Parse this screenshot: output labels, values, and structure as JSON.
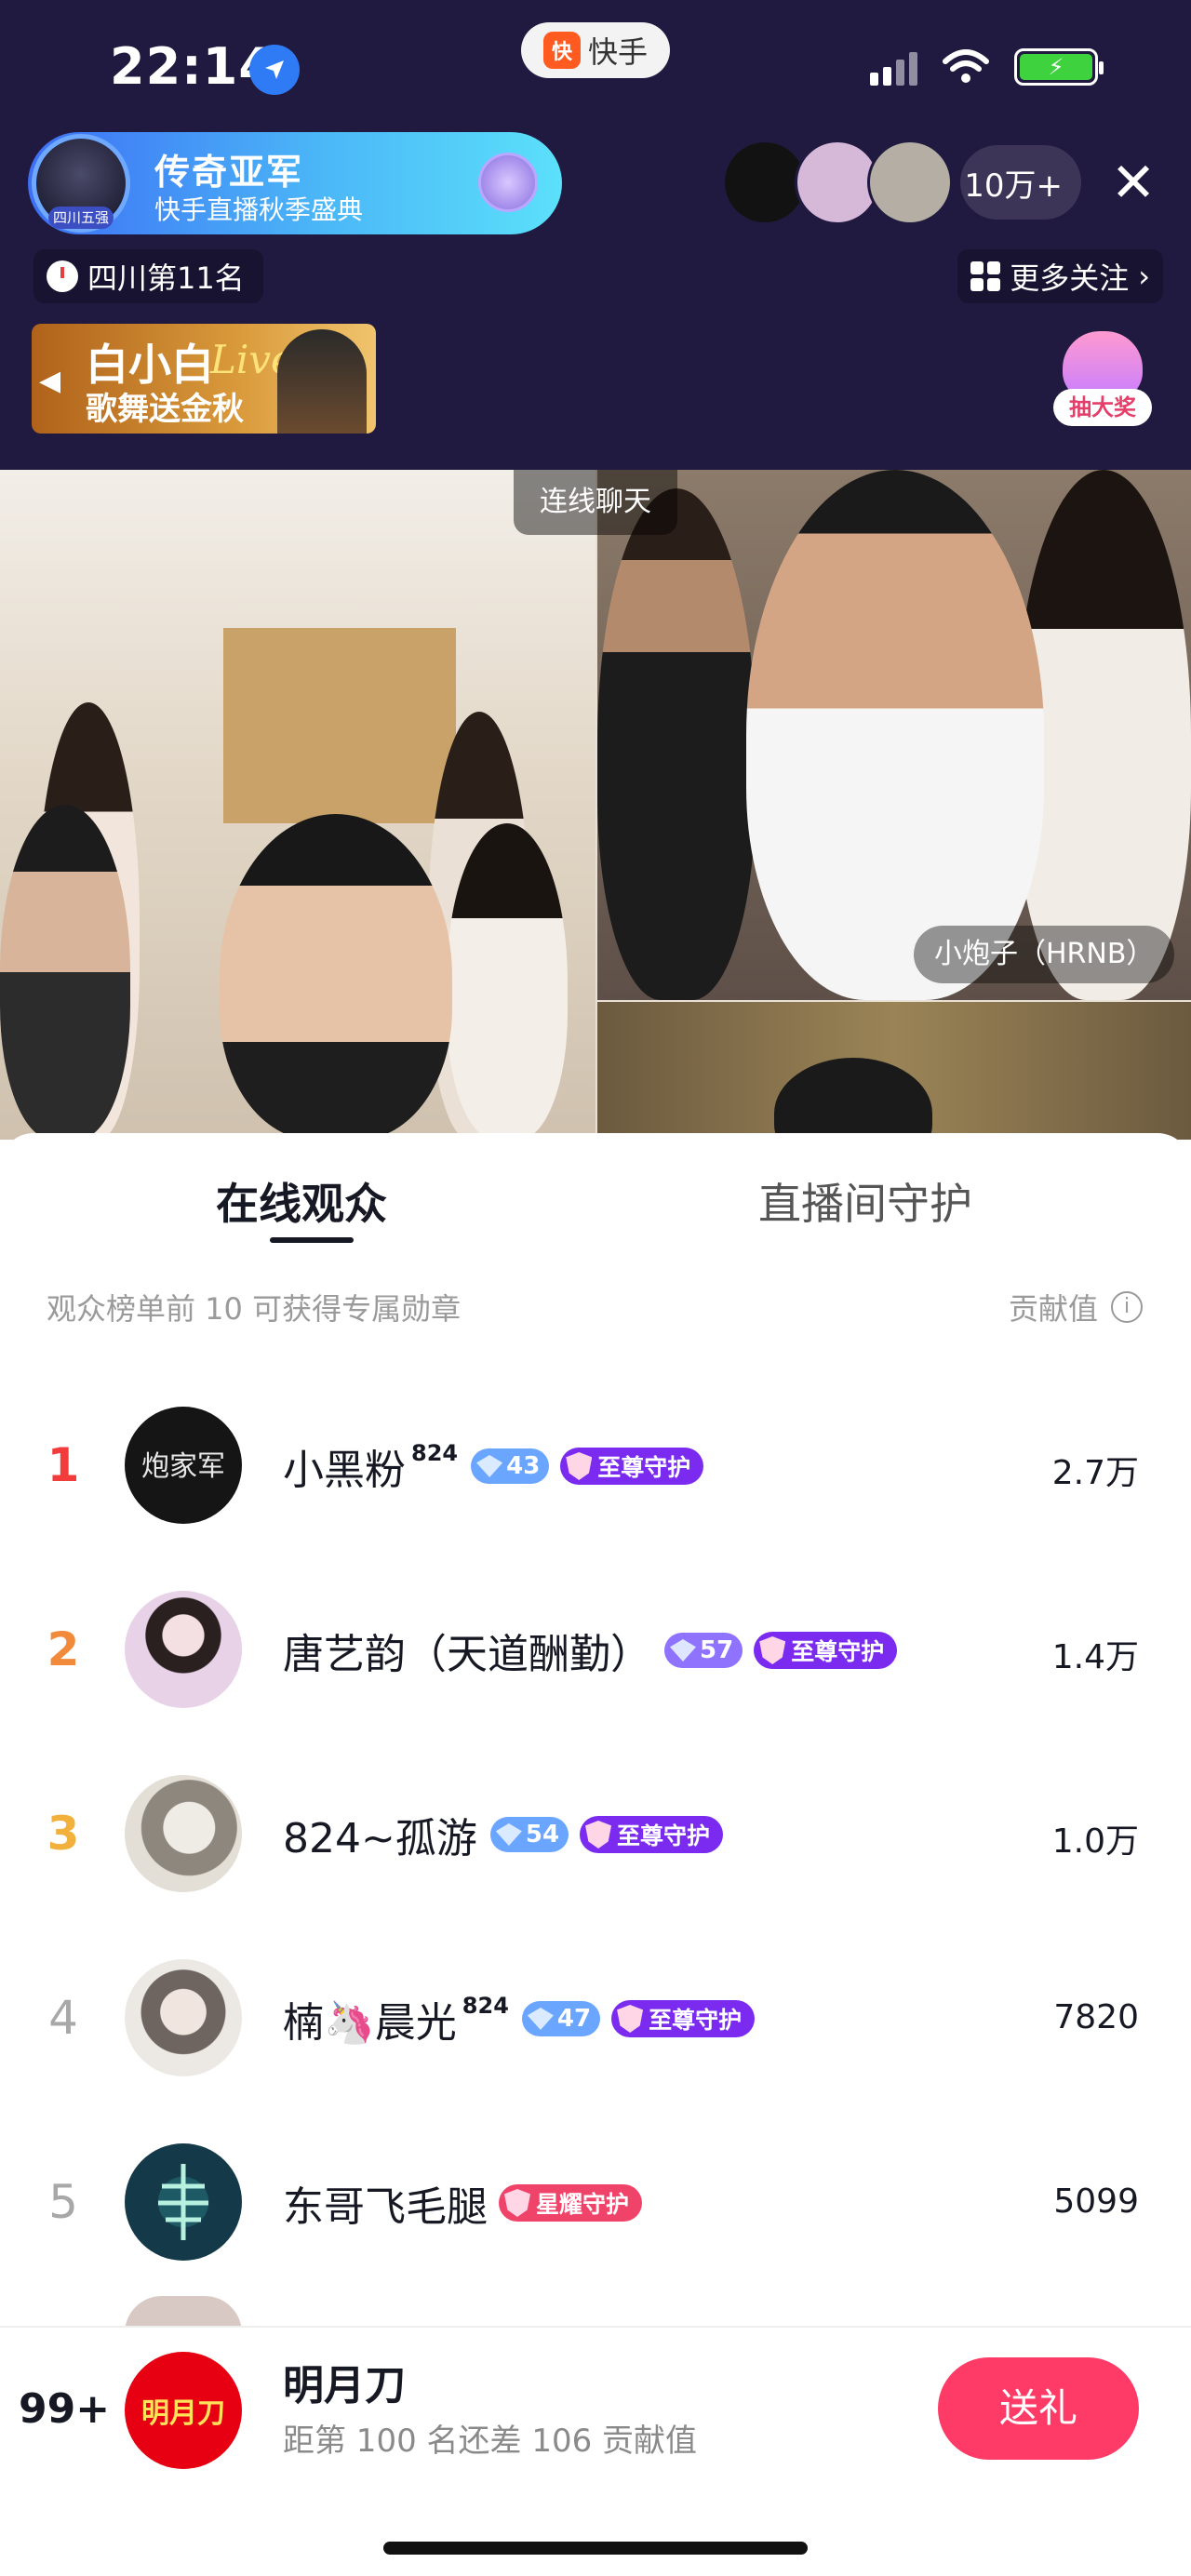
{
  "status_bar": {
    "time": "22:14",
    "battery": "⚡"
  },
  "app_badge": {
    "logo": "快",
    "name": "快手"
  },
  "host": {
    "rank_tag": "四川五强",
    "title": "传奇亚军",
    "subtitle": "快手直播秋季盛典",
    "region_rank": "四川第11名"
  },
  "viewers": {
    "count": "10万+"
  },
  "more_follow": "更多关注",
  "promo": {
    "title": "白小白",
    "live_word": "Live",
    "subtitle": "歌舞送金秋"
  },
  "lottery": {
    "label": "抽大奖"
  },
  "video": {
    "chat_label": "连线聊天",
    "guest_name": "小炮子（HRNB）"
  },
  "sheet": {
    "tabs": [
      {
        "label": "在线观众"
      },
      {
        "label": "直播间守护"
      }
    ],
    "hint": "观众榜单前 10 可获得专属勋章",
    "contrib_label": "贡献值",
    "rows": [
      {
        "rank": "1",
        "rank_color": "#f23c3c",
        "name": "小黑粉",
        "sup": "824",
        "level": "43",
        "level_color": "#6aa6ff",
        "guard": "至尊守护",
        "guard_color": "#7b2bf0",
        "value": "2.7万",
        "avatar_color": "#151515"
      },
      {
        "rank": "2",
        "rank_color": "#f28a3c",
        "name": "唐艺韵（天道酬勤）",
        "sup": "",
        "level": "57",
        "level_color": "#8f73ff",
        "guard": "至尊守护",
        "guard_color": "#7b2bf0",
        "value": "1.4万",
        "avatar_color": "#d9b8d6"
      },
      {
        "rank": "3",
        "rank_color": "#f2b13c",
        "name": "824~孤游",
        "sup": "",
        "level": "54",
        "level_color": "#6aa6ff",
        "guard": "至尊守护",
        "guard_color": "#7b2bf0",
        "value": "1.0万",
        "avatar_color": "#b8b2a8"
      },
      {
        "rank": "4",
        "rank_color": "#a8a8a8",
        "name": "楠🦄晨光",
        "sup": "824",
        "level": "47",
        "level_color": "#6aa6ff",
        "guard": "至尊守护",
        "guard_color": "#7b2bf0",
        "value": "7820",
        "avatar_color": "#c9c4c0"
      },
      {
        "rank": "5",
        "rank_color": "#a8a8a8",
        "name": "东哥飞毛腿",
        "sup": "",
        "level": "",
        "level_color": "",
        "guard": "星耀守护",
        "guard_color": "#f0436a",
        "value": "5099",
        "avatar_color": "#143a4a"
      }
    ]
  },
  "me": {
    "rank": "99+",
    "avatar_text": "明月刀",
    "name": "明月刀",
    "gap_text": "距第 100 名还差 106 贡献值",
    "gift_label": "送礼"
  }
}
